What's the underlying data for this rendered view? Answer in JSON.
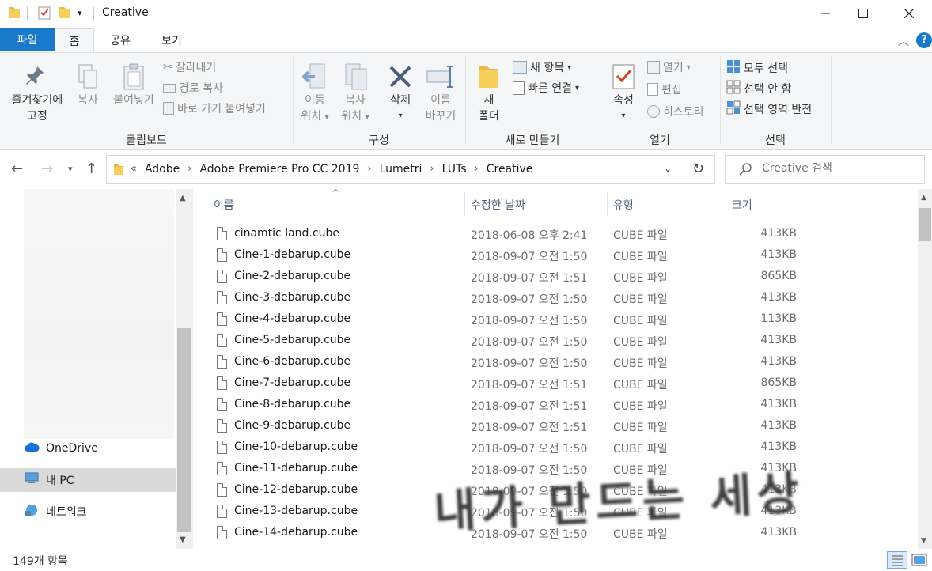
{
  "window": {
    "title": "Creative"
  },
  "tabs": {
    "file": "파일",
    "home": "홈",
    "share": "공유",
    "view": "보기"
  },
  "ribbon": {
    "clipboard": {
      "label": "클립보드",
      "pin_line1": "즐겨찾기에",
      "pin_line2": "고정",
      "copy": "복사",
      "paste": "붙여넣기",
      "cut": "잘라내기",
      "copy_path": "경로 복사",
      "paste_shortcut": "바로 가기 붙여넣기"
    },
    "organize": {
      "label": "구성",
      "move_line1": "이동",
      "move_line2": "위치",
      "copyto_line1": "복사",
      "copyto_line2": "위치",
      "delete": "삭제",
      "rename_line1": "이름",
      "rename_line2": "바꾸기"
    },
    "new": {
      "label": "새로 만들기",
      "new_folder_line1": "새",
      "new_folder_line2": "폴더",
      "new_item": "새 항목",
      "easy_access": "빠른 연결"
    },
    "open": {
      "label": "열기",
      "properties": "속성",
      "open": "열기",
      "edit": "편집",
      "history": "히스토리"
    },
    "select": {
      "label": "선택",
      "select_all": "모두 선택",
      "select_none": "선택 안 함",
      "invert": "선택 영역 반전"
    }
  },
  "address": {
    "crumbs": [
      "Adobe",
      "Adobe Premiere Pro CC 2019",
      "Lumetri",
      "LUTs",
      "Creative"
    ],
    "overflow": "«",
    "search_placeholder": "Creative 검색"
  },
  "nav": {
    "onedrive": "OneDrive",
    "mypc": "내 PC",
    "network": "네트워크"
  },
  "columns": {
    "name": "이름",
    "date": "수정한 날짜",
    "type": "유형",
    "size": "크기"
  },
  "files": [
    {
      "name": "cinamtic land.cube",
      "date": "2018-06-08 오후 2:41",
      "type": "CUBE 파일",
      "size": "413KB"
    },
    {
      "name": "Cine-1-debarup.cube",
      "date": "2018-09-07 오전 1:50",
      "type": "CUBE 파일",
      "size": "413KB"
    },
    {
      "name": "Cine-2-debarup.cube",
      "date": "2018-09-07 오전 1:51",
      "type": "CUBE 파일",
      "size": "865KB"
    },
    {
      "name": "Cine-3-debarup.cube",
      "date": "2018-09-07 오전 1:50",
      "type": "CUBE 파일",
      "size": "413KB"
    },
    {
      "name": "Cine-4-debarup.cube",
      "date": "2018-09-07 오전 1:50",
      "type": "CUBE 파일",
      "size": "113KB"
    },
    {
      "name": "Cine-5-debarup.cube",
      "date": "2018-09-07 오전 1:50",
      "type": "CUBE 파일",
      "size": "413KB"
    },
    {
      "name": "Cine-6-debarup.cube",
      "date": "2018-09-07 오전 1:50",
      "type": "CUBE 파일",
      "size": "413KB"
    },
    {
      "name": "Cine-7-debarup.cube",
      "date": "2018-09-07 오전 1:51",
      "type": "CUBE 파일",
      "size": "865KB"
    },
    {
      "name": "Cine-8-debarup.cube",
      "date": "2018-09-07 오전 1:51",
      "type": "CUBE 파일",
      "size": "413KB"
    },
    {
      "name": "Cine-9-debarup.cube",
      "date": "2018-09-07 오전 1:51",
      "type": "CUBE 파일",
      "size": "413KB"
    },
    {
      "name": "Cine-10-debarup.cube",
      "date": "2018-09-07 오전 1:50",
      "type": "CUBE 파일",
      "size": "413KB"
    },
    {
      "name": "Cine-11-debarup.cube",
      "date": "2018-09-07 오전 1:50",
      "type": "CUBE 파일",
      "size": "413KB"
    },
    {
      "name": "Cine-12-debarup.cube",
      "date": "2018-09-07 오전 1:50",
      "type": "CUBE 파일",
      "size": "413KB"
    },
    {
      "name": "Cine-13-debarup.cube",
      "date": "2018-09-07 오전 1:50",
      "type": "CUBE 파일",
      "size": "413KB"
    },
    {
      "name": "Cine-14-debarup.cube",
      "date": "2018-09-07 오전 1:50",
      "type": "CUBE 파일",
      "size": "413KB"
    }
  ],
  "status": {
    "count": "149개 항목"
  },
  "watermark": "내가 만드는 세상"
}
